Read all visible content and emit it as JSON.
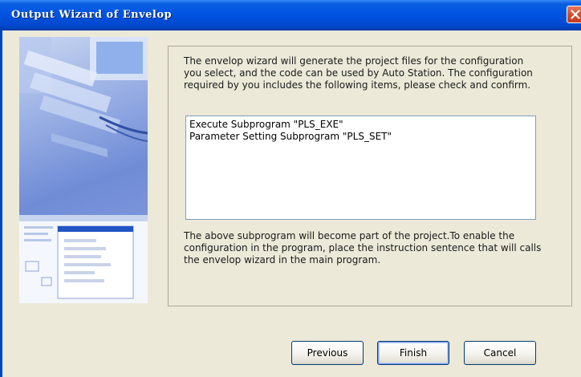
{
  "window": {
    "title": "Output Wizard of Envelop",
    "close_icon": "close-icon"
  },
  "wizard": {
    "intro_text": "The envelop wizard will generate the project files for the configuration you select, and the code can be used by Auto Station. The configuration required by you includes the following items, please check and confirm.",
    "items": [
      "Execute Subprogram \"PLS_EXE\"",
      "Parameter Setting Subprogram \"PLS_SET\""
    ],
    "note_text": "The above subprogram will become part of the project.To enable the configuration in the program, place the instruction sentence that will calls the envelop wizard in the main program."
  },
  "buttons": {
    "previous": "Previous",
    "finish": "Finish",
    "cancel": "Cancel"
  },
  "colors": {
    "titlebar": "#0054e3",
    "dialog_bg": "#ece9d8",
    "close_button": "#d4492a"
  }
}
